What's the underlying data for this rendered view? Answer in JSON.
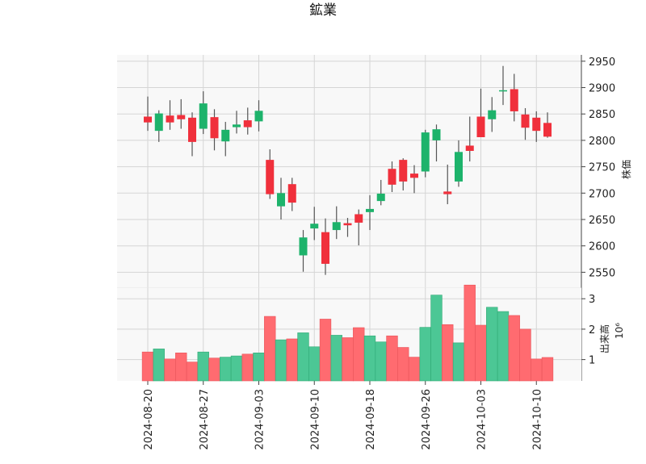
{
  "chart_data": {
    "type": "candlestick",
    "title": "鉱業",
    "price_axis": {
      "label": "株価",
      "ylim": [
        2520,
        2962
      ],
      "ticks": [
        2550,
        2600,
        2650,
        2700,
        2750,
        2800,
        2850,
        2900,
        2950
      ]
    },
    "volume_axis": {
      "label": "出来高",
      "exponent_label": "10⁶",
      "ylim": [
        0.3,
        3.35
      ],
      "ticks": [
        1,
        2,
        3
      ]
    },
    "x_tick_labels": [
      "2024-08-20",
      "2024-08-27",
      "2024-09-03",
      "2024-09-10",
      "2024-09-18",
      "2024-09-26",
      "2024-10-03",
      "2024-10-10"
    ],
    "x_tick_indices": [
      0,
      5,
      10,
      15,
      20,
      25,
      30,
      35
    ],
    "colors": {
      "up": "#1db36b",
      "down": "#f0303c",
      "up_volume": "#4cc795",
      "down_volume": "#ff6b70",
      "wick": "#555555"
    },
    "grid": true,
    "candles": [
      {
        "date": "2024-08-20",
        "open": 2845,
        "high": 2883,
        "low": 2818,
        "close": 2834,
        "volume": 1.25
      },
      {
        "date": "2024-08-21",
        "open": 2818,
        "high": 2857,
        "low": 2797,
        "close": 2851,
        "volume": 1.35
      },
      {
        "date": "2024-08-22",
        "open": 2847,
        "high": 2876,
        "low": 2820,
        "close": 2834,
        "volume": 1.02
      },
      {
        "date": "2024-08-23",
        "open": 2848,
        "high": 2878,
        "low": 2822,
        "close": 2840,
        "volume": 1.22
      },
      {
        "date": "2024-08-26",
        "open": 2843,
        "high": 2853,
        "low": 2770,
        "close": 2797,
        "volume": 0.92
      },
      {
        "date": "2024-08-27",
        "open": 2822,
        "high": 2893,
        "low": 2812,
        "close": 2870,
        "volume": 1.25
      },
      {
        "date": "2024-08-28",
        "open": 2844,
        "high": 2859,
        "low": 2781,
        "close": 2804,
        "volume": 1.05
      },
      {
        "date": "2024-08-29",
        "open": 2798,
        "high": 2835,
        "low": 2770,
        "close": 2820,
        "volume": 1.08
      },
      {
        "date": "2024-08-30",
        "open": 2825,
        "high": 2856,
        "low": 2813,
        "close": 2830,
        "volume": 1.12
      },
      {
        "date": "2024-09-02",
        "open": 2838,
        "high": 2862,
        "low": 2811,
        "close": 2825,
        "volume": 1.18
      },
      {
        "date": "2024-09-03",
        "open": 2836,
        "high": 2876,
        "low": 2817,
        "close": 2856,
        "volume": 1.22
      },
      {
        "date": "2024-09-04",
        "open": 2763,
        "high": 2783,
        "low": 2689,
        "close": 2698,
        "volume": 2.42
      },
      {
        "date": "2024-09-05",
        "open": 2675,
        "high": 2729,
        "low": 2650,
        "close": 2700,
        "volume": 1.65
      },
      {
        "date": "2024-09-06",
        "open": 2717,
        "high": 2729,
        "low": 2666,
        "close": 2682,
        "volume": 1.68
      },
      {
        "date": "2024-09-09",
        "open": 2582,
        "high": 2630,
        "low": 2551,
        "close": 2616,
        "volume": 1.88
      },
      {
        "date": "2024-09-10",
        "open": 2633,
        "high": 2674,
        "low": 2611,
        "close": 2642,
        "volume": 1.42
      },
      {
        "date": "2024-09-11",
        "open": 2626,
        "high": 2652,
        "low": 2545,
        "close": 2566,
        "volume": 2.33
      },
      {
        "date": "2024-09-12",
        "open": 2630,
        "high": 2675,
        "low": 2613,
        "close": 2645,
        "volume": 1.8
      },
      {
        "date": "2024-09-13",
        "open": 2643,
        "high": 2653,
        "low": 2617,
        "close": 2639,
        "volume": 1.72
      },
      {
        "date": "2024-09-17",
        "open": 2660,
        "high": 2669,
        "low": 2601,
        "close": 2644,
        "volume": 2.05
      },
      {
        "date": "2024-09-18",
        "open": 2664,
        "high": 2696,
        "low": 2630,
        "close": 2670,
        "volume": 1.78
      },
      {
        "date": "2024-09-19",
        "open": 2685,
        "high": 2725,
        "low": 2677,
        "close": 2699,
        "volume": 1.58
      },
      {
        "date": "2024-09-20",
        "open": 2746,
        "high": 2760,
        "low": 2702,
        "close": 2716,
        "volume": 1.78
      },
      {
        "date": "2024-09-24",
        "open": 2763,
        "high": 2766,
        "low": 2705,
        "close": 2722,
        "volume": 1.4
      },
      {
        "date": "2024-09-25",
        "open": 2737,
        "high": 2753,
        "low": 2700,
        "close": 2729,
        "volume": 1.08
      },
      {
        "date": "2024-09-26",
        "open": 2741,
        "high": 2820,
        "low": 2730,
        "close": 2815,
        "volume": 2.06
      },
      {
        "date": "2024-09-27",
        "open": 2800,
        "high": 2830,
        "low": 2760,
        "close": 2821,
        "volume": 3.12
      },
      {
        "date": "2024-09-30",
        "open": 2703,
        "high": 2754,
        "low": 2679,
        "close": 2698,
        "volume": 2.15
      },
      {
        "date": "2024-10-01",
        "open": 2722,
        "high": 2800,
        "low": 2712,
        "close": 2778,
        "volume": 1.55
      },
      {
        "date": "2024-10-02",
        "open": 2790,
        "high": 2845,
        "low": 2760,
        "close": 2780,
        "volume": 3.45
      },
      {
        "date": "2024-10-03",
        "open": 2845,
        "high": 2898,
        "low": 2806,
        "close": 2806,
        "volume": 2.13
      },
      {
        "date": "2024-10-04",
        "open": 2840,
        "high": 2882,
        "low": 2816,
        "close": 2857,
        "volume": 2.72
      },
      {
        "date": "2024-10-07",
        "open": 2893,
        "high": 2941,
        "low": 2867,
        "close": 2895,
        "volume": 2.58
      },
      {
        "date": "2024-10-08",
        "open": 2897,
        "high": 2926,
        "low": 2836,
        "close": 2855,
        "volume": 2.45
      },
      {
        "date": "2024-10-09",
        "open": 2849,
        "high": 2861,
        "low": 2801,
        "close": 2824,
        "volume": 2.0
      },
      {
        "date": "2024-10-10",
        "open": 2843,
        "high": 2855,
        "low": 2797,
        "close": 2818,
        "volume": 1.02
      },
      {
        "date": "2024-10-11",
        "open": 2833,
        "high": 2853,
        "low": 2805,
        "close": 2807,
        "volume": 1.07
      }
    ]
  }
}
